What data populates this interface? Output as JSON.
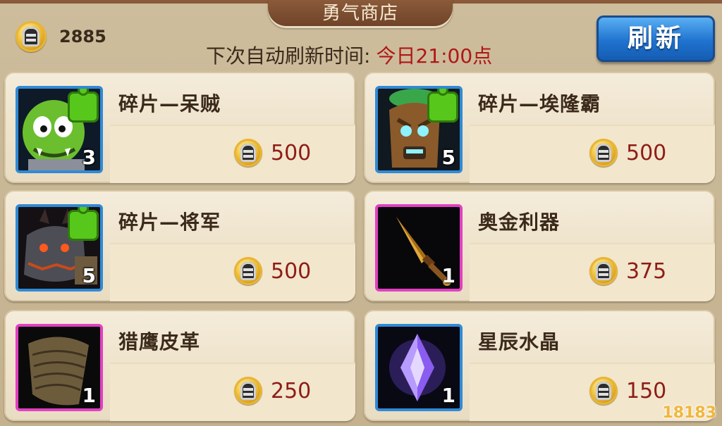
{
  "shop": {
    "title": "勇气商店",
    "currency_amount": "2885",
    "refresh_label": "下次自动刷新时间:",
    "refresh_time": "今日21:00点",
    "refresh_button": "刷新"
  },
  "items": [
    {
      "name": "碎片—呆贼",
      "qty": "3",
      "price": "500"
    },
    {
      "name": "碎片—埃隆霸",
      "qty": "5",
      "price": "500"
    },
    {
      "name": "碎片—将军",
      "qty": "5",
      "price": "500"
    },
    {
      "name": "奥金利器",
      "qty": "1",
      "price": "375"
    },
    {
      "name": "猎鹰皮革",
      "qty": "1",
      "price": "250"
    },
    {
      "name": "星辰水晶",
      "qty": "1",
      "price": "150"
    }
  ],
  "watermark": "18183",
  "colors": {
    "blue_frame": "#2f8ad6",
    "pink_frame": "#e23fc2",
    "price_text": "#8d1d15",
    "refresh_button": "#1f73cf"
  }
}
